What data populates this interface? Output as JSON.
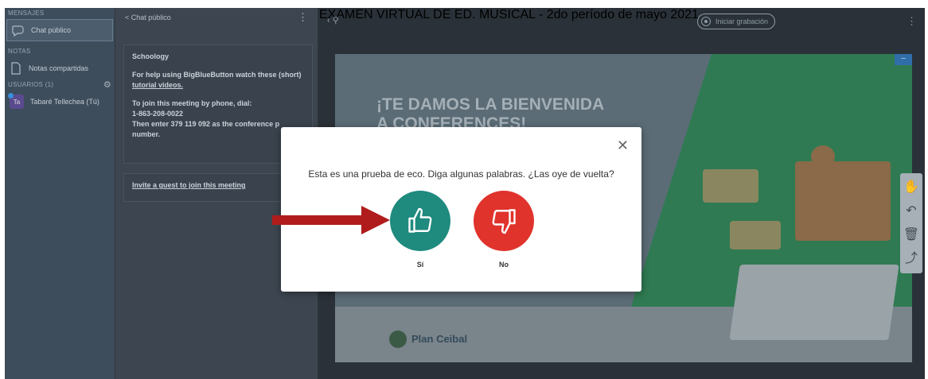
{
  "app": {
    "meeting_title": "EXAMEN VIRTUAL DE ED. MUSICAL - 2do período de mayo 2021",
    "record_label": "Iniciar grabación"
  },
  "sidebar": {
    "messages_header": "MENSAJES",
    "public_chat": "Chat público",
    "notes_header": "NOTAS",
    "shared_notes": "Notas compartidas",
    "users_header": "USUARIOS (1)",
    "user_name": "Tabaré Tellechea (Tú)",
    "user_initials": "Ta"
  },
  "chat": {
    "back_title": "< Chat público",
    "welcome_title": "Schoology",
    "help_line": "For help using BigBlueButton watch these (short)",
    "help_link": "tutorial videos.",
    "phone_line": "To join this meeting by phone, dial:",
    "phone_number": "1-863-208-0022",
    "conference_line": "Then enter 379 119 092 as the conference p",
    "conference_tail": "number.",
    "invite_link": "Invite a guest to join this meeting"
  },
  "slide": {
    "welcome_line1": "¡TE DAMOS LA BIENVENIDA",
    "welcome_line2": "A CONFERENCES!",
    "logo": "Plan Ceibal"
  },
  "echo_modal": {
    "question": "Esta es una prueba de eco. Diga algunas palabras. ¿Las oye de vuelta?",
    "yes_label": "Sí",
    "no_label": "No"
  },
  "colors": {
    "yes": "#1f8a7e",
    "no": "#e0332c",
    "arrow": "#b01c1c"
  }
}
